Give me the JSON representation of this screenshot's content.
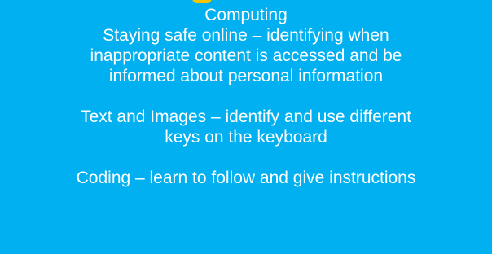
{
  "heading": "Computing",
  "paragraphs": [
    {
      "lines": [
        "Staying safe online – identifying when",
        "inappropriate content is accessed and be",
        "informed about personal information"
      ]
    },
    {
      "lines": [
        "Text and Images – identify and use different",
        "keys on the keyboard"
      ]
    },
    {
      "lines": [
        "Coding – learn to follow and give instructions"
      ]
    }
  ],
  "colors": {
    "background": "#00B0F0",
    "text": "#FFFFFF",
    "accent": "#F5C400"
  }
}
